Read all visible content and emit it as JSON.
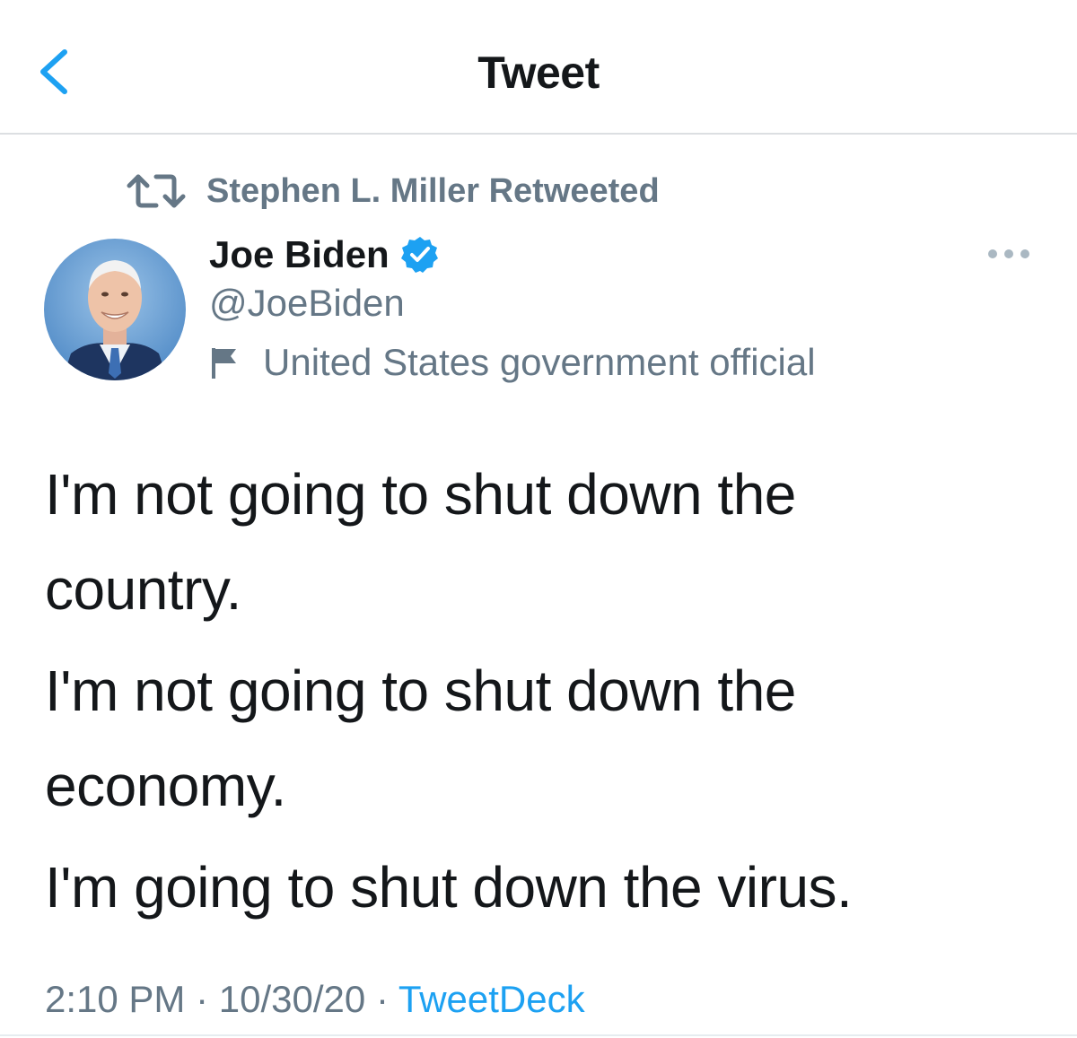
{
  "header": {
    "title": "Tweet"
  },
  "retweet": {
    "label": "Stephen L. Miller Retweeted"
  },
  "author": {
    "name": "Joe Biden",
    "handle": "@JoeBiden",
    "label": "United States government official",
    "verified": true
  },
  "tweet": {
    "paragraphs": [
      "I'm not going to shut down the country.",
      "I'm not going to shut down the economy.",
      "I'm going to shut down the virus."
    ]
  },
  "meta": {
    "time": "2:10 PM",
    "separator": "·",
    "date": "10/30/20",
    "source": "TweetDeck"
  },
  "icons": {
    "back": "chevron-left-icon",
    "retweet": "retweet-icon",
    "verified": "verified-badge-icon",
    "flag": "flag-icon",
    "more": "more-horizontal-icon"
  },
  "colors": {
    "accent": "#1da1f2",
    "text_primary": "#14171a",
    "text_secondary": "#657786",
    "divider": "#dcdfe2"
  }
}
